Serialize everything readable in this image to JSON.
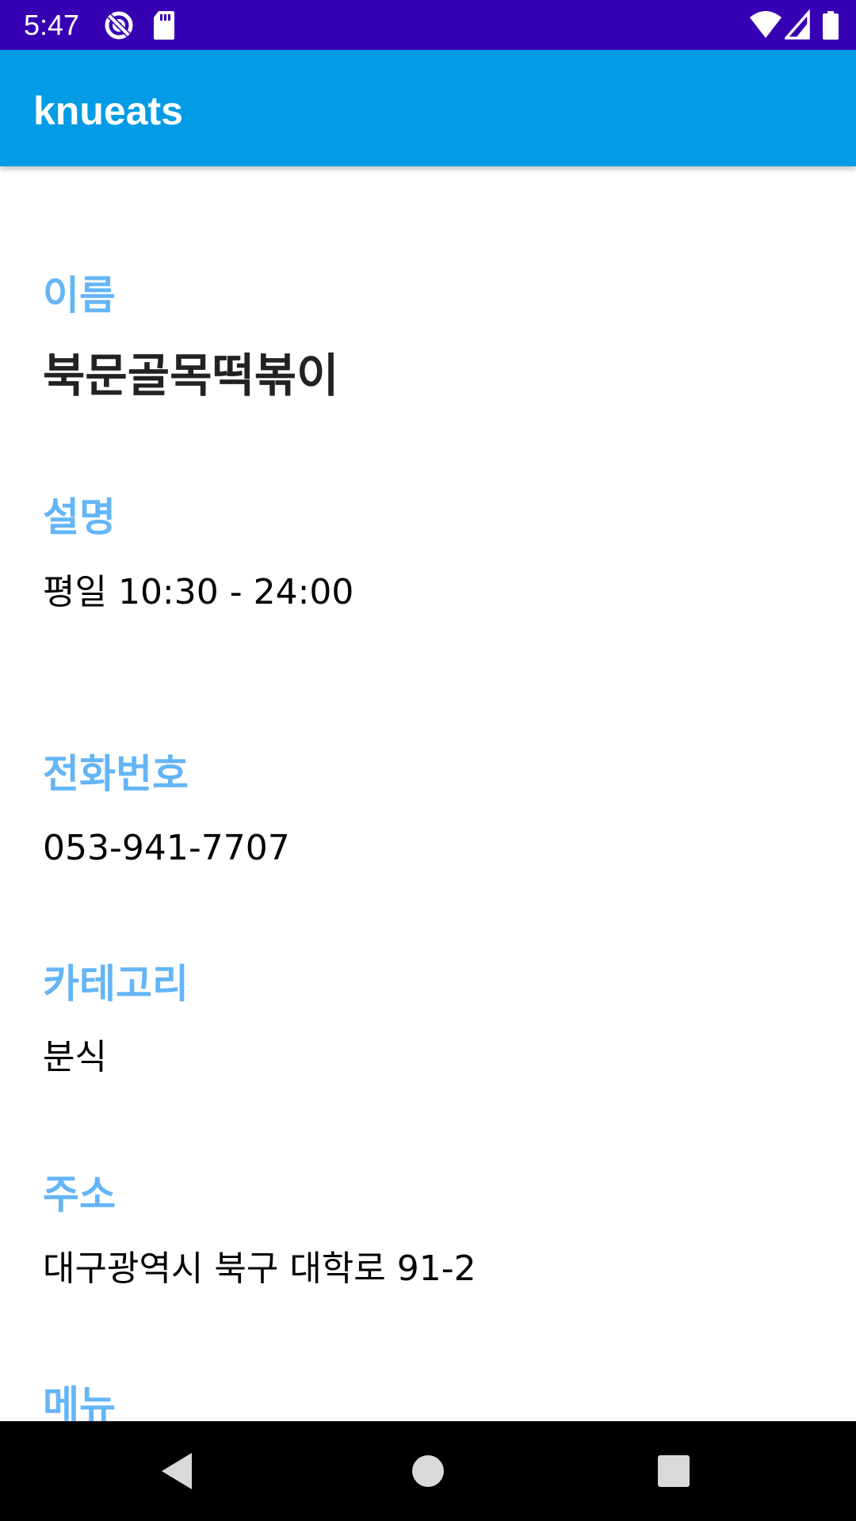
{
  "status_bar": {
    "time": "5:47",
    "icons": [
      "sync-disabled-icon",
      "sd-card-icon",
      "wifi-icon",
      "cell-signal-icon",
      "battery-icon"
    ],
    "background": "#3700b3"
  },
  "app_bar": {
    "title": "knueats",
    "background": "#039be5"
  },
  "detail": {
    "label_color": "#64b5f6",
    "name_label": "이름",
    "name_value": "북문골목떡볶이",
    "description_label": "설명",
    "description_value": "평일 10:30 - 24:00",
    "phone_label": "전화번호",
    "phone_value": "053-941-7707",
    "category_label": "카테고리",
    "category_value": "분식",
    "address_label": "주소",
    "address_value": "대구광역시 북구 대학로 91-2",
    "menu_label": "메뉴"
  },
  "nav_bar": {
    "buttons": [
      "back-icon",
      "home-icon",
      "recents-icon"
    ]
  }
}
